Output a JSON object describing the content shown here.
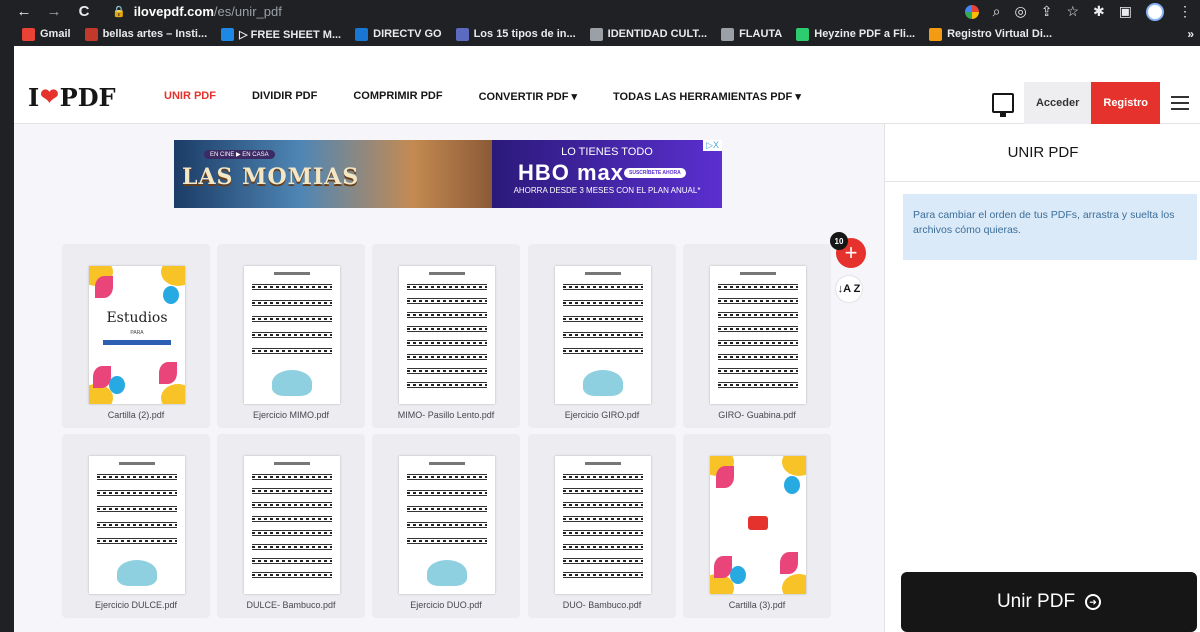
{
  "browser": {
    "url_host": "ilovepdf.com",
    "url_path": "/es/unir_pdf",
    "bookmarks": [
      {
        "label": "Gmail",
        "icon": "gmail-icon",
        "color": "#ea4335"
      },
      {
        "label": "bellas artes – Insti...",
        "icon": "site-icon",
        "color": "#c0392b"
      },
      {
        "label": "▷ FREE SHEET M...",
        "icon": "music-icon",
        "color": "#1e88e5"
      },
      {
        "label": "DIRECTV GO",
        "icon": "directv-icon",
        "color": "#1976d2"
      },
      {
        "label": "Los 15 tipos de in...",
        "icon": "site-icon",
        "color": "#5c6bc0"
      },
      {
        "label": "IDENTIDAD CULT...",
        "icon": "folder-icon",
        "color": "#9aa0a6"
      },
      {
        "label": "FLAUTA",
        "icon": "folder-icon",
        "color": "#9aa0a6"
      },
      {
        "label": "Heyzine PDF a Fli...",
        "icon": "heyzine-icon",
        "color": "#2ecc71"
      },
      {
        "label": "Registro Virtual Di...",
        "icon": "site-icon",
        "color": "#f39c12"
      }
    ],
    "more": "»"
  },
  "nav": {
    "logo_left": "I",
    "logo_right": "PDF",
    "menu": [
      "UNIR PDF",
      "DIVIDIR PDF",
      "COMPRIMIR PDF",
      "CONVERTIR PDF ▾",
      "TODAS LAS HERRAMIENTAS PDF ▾"
    ],
    "login": "Acceder",
    "register": "Registro",
    "brand_color": "#e5322d"
  },
  "ad": {
    "badge": "EN CINE ▶ EN CASA",
    "movie_title": "LAS MOMIAS",
    "tagline": "LO TIENES TODO",
    "brand": "HBO max",
    "cta": "SUSCRÍBETE AHORA",
    "offer": "AHORRA DESDE 3 MESES CON EL PLAN ANUAL*",
    "close": "▷X"
  },
  "files": {
    "count": "10",
    "sort_icon": "↓A Z",
    "items": [
      {
        "name": "Cartilla (2).pdf",
        "kind": "cover"
      },
      {
        "name": "Ejercicio MIMO.pdf",
        "kind": "exercise"
      },
      {
        "name": "MIMO- Pasillo Lento.pdf",
        "kind": "score"
      },
      {
        "name": "Ejercicio GIRO.pdf",
        "kind": "exercise"
      },
      {
        "name": "GIRO- Guabina.pdf",
        "kind": "score"
      },
      {
        "name": "Ejercicio DULCE.pdf",
        "kind": "exercise"
      },
      {
        "name": "DULCE- Bambuco.pdf",
        "kind": "score"
      },
      {
        "name": "Ejercicio DUO.pdf",
        "kind": "exercise"
      },
      {
        "name": "DUO- Bambuco.pdf",
        "kind": "score"
      },
      {
        "name": "Cartilla (3).pdf",
        "kind": "cover2"
      }
    ],
    "cover_title": "Estudios",
    "cover_sub": "PARA"
  },
  "sidebar": {
    "title": "UNIR PDF",
    "info": "Para cambiar el orden de tus PDFs, arrastra y suelta los archivos cómo quieras.",
    "merge_label": "Unir PDF",
    "merge_icon": "arrow-circle-right-icon"
  }
}
